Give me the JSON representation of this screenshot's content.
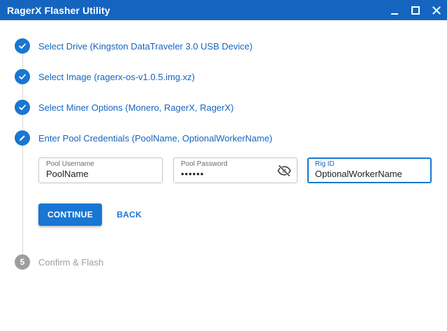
{
  "window": {
    "title": "RagerX Flasher Utility",
    "controls": {
      "minimize": "minimize-icon",
      "maximize": "maximize-icon",
      "close": "close-icon"
    }
  },
  "colors": {
    "accent": "#1976d2",
    "titlebar": "#1565c0",
    "pending": "#9e9e9e"
  },
  "steps": [
    {
      "label": "Select Drive (Kingston DataTraveler 3.0 USB Device)",
      "state": "completed",
      "icon": "check-icon"
    },
    {
      "label": "Select Image (ragerx-os-v1.0.5.img.xz)",
      "state": "completed",
      "icon": "check-icon"
    },
    {
      "label": "Select Miner Options (Monero, RagerX, RagerX)",
      "state": "completed",
      "icon": "check-icon"
    },
    {
      "label": "Enter Pool Credentials (PoolName, OptionalWorkerName)",
      "state": "active",
      "icon": "edit-icon"
    },
    {
      "number": "5",
      "label": "Confirm & Flash",
      "state": "pending"
    }
  ],
  "form": {
    "pool_username": {
      "label": "Pool Username",
      "value": "PoolName"
    },
    "pool_password": {
      "label": "Pool Password",
      "value": "••••••",
      "toggle_icon": "visibility-off-icon"
    },
    "rig_id": {
      "label": "Rig ID",
      "value": "OptionalWorkerName"
    }
  },
  "actions": {
    "continue_label": "CONTINUE",
    "back_label": "BACK"
  }
}
